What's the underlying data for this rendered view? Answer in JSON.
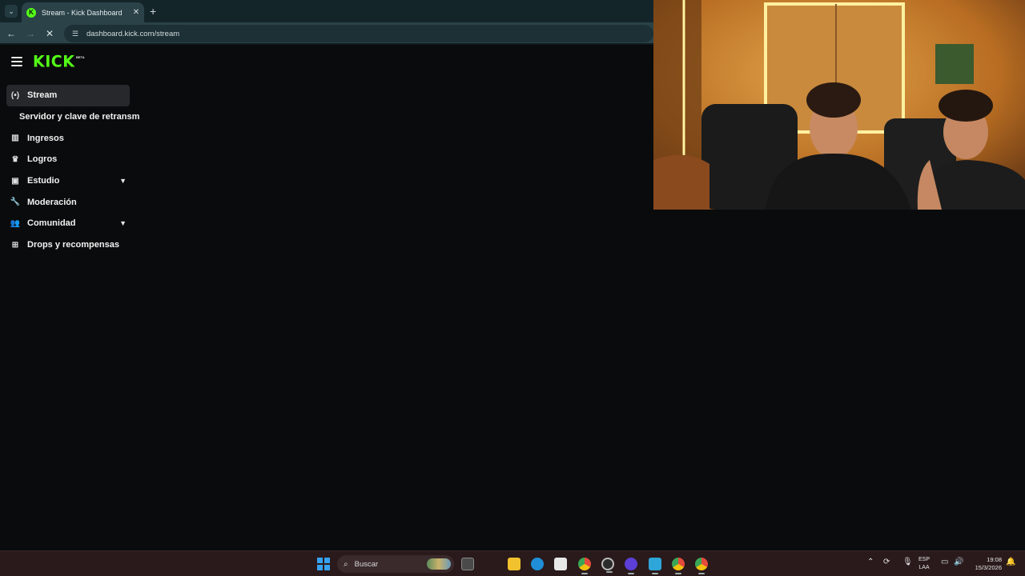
{
  "browser": {
    "tab": {
      "title": "Stream - Kick Dashboard"
    },
    "url": "dashboard.kick.com/stream",
    "new_tab_label": "+"
  },
  "app": {
    "logo_text": "KICK",
    "logo_badge": "BETA"
  },
  "sidebar": {
    "items": [
      {
        "label": "Stream",
        "icon": "broadcast-icon",
        "active": true
      },
      {
        "label": "Servidor y clave de retransm",
        "sub": true
      },
      {
        "label": "Ingresos",
        "icon": "chart-icon"
      },
      {
        "label": "Logros",
        "icon": "trophy-icon"
      },
      {
        "label": "Estudio",
        "icon": "studio-icon",
        "expandable": true
      },
      {
        "label": "Moderación",
        "icon": "wrench-icon"
      },
      {
        "label": "Comunidad",
        "icon": "people-icon",
        "expandable": true
      },
      {
        "label": "Drops y recompensas",
        "icon": "gift-icon"
      }
    ]
  },
  "taskbar": {
    "search_placeholder": "Buscar",
    "lang_line1": "ESP",
    "lang_line2": "LAA",
    "time": "19:08",
    "date": "15/3/2026"
  },
  "colors": {
    "brand": "#53fc18",
    "background": "#0a0b0c",
    "active_item": "#26282b",
    "chrome": "#2a4248",
    "taskbar": "#2a1a1b"
  }
}
